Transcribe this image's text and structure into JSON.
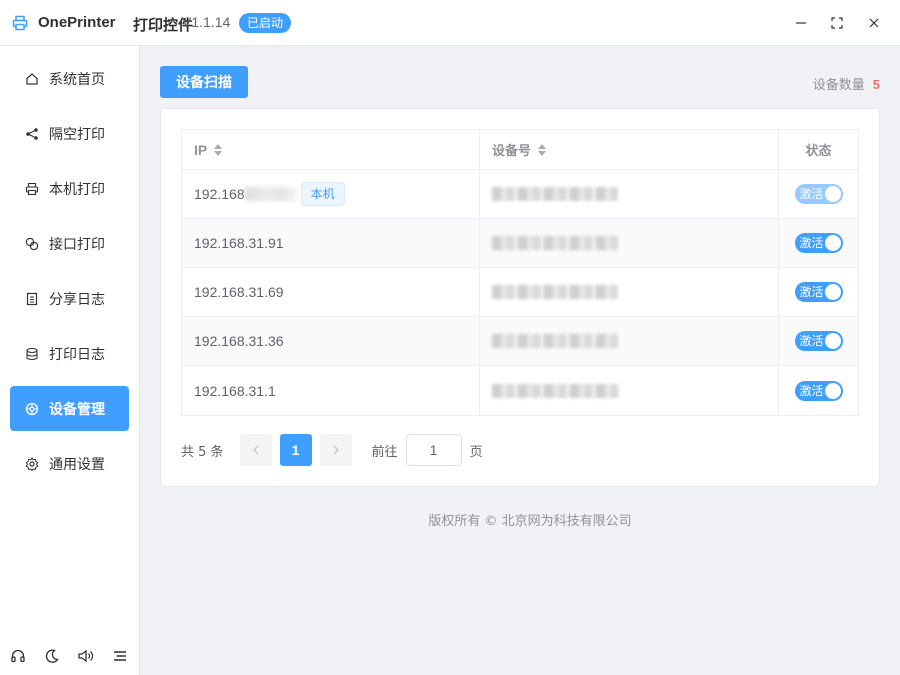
{
  "titlebar": {
    "app_name": "OnePrinter",
    "app_sub": "打印控件",
    "version": "V1.1.14",
    "status_badge": "已启动"
  },
  "sidebar": {
    "items": [
      {
        "label": "系统首页",
        "icon": "home-icon"
      },
      {
        "label": "隔空打印",
        "icon": "share-icon"
      },
      {
        "label": "本机打印",
        "icon": "printer-icon"
      },
      {
        "label": "接口打印",
        "icon": "link-icon"
      },
      {
        "label": "分享日志",
        "icon": "document-icon"
      },
      {
        "label": "打印日志",
        "icon": "database-icon"
      },
      {
        "label": "设备管理",
        "icon": "device-icon",
        "active": true
      },
      {
        "label": "通用设置",
        "icon": "gear-icon"
      }
    ],
    "footer_icons": [
      "headset-icon",
      "moon-icon",
      "speaker-icon",
      "menu-icon"
    ]
  },
  "main": {
    "scan_button": "设备扫描",
    "device_count_label": "设备数量",
    "device_count": "5"
  },
  "table": {
    "headers": {
      "ip": "IP",
      "device": "设备号",
      "status": "状态"
    },
    "local_tag": "本机",
    "rows": [
      {
        "ip": "192.168",
        "is_local": true,
        "status": "激活"
      },
      {
        "ip": "192.168.31.91",
        "status": "激活"
      },
      {
        "ip": "192.168.31.69",
        "status": "激活"
      },
      {
        "ip": "192.168.31.36",
        "status": "激活"
      },
      {
        "ip": "192.168.31.1",
        "status": "激活"
      }
    ]
  },
  "pagination": {
    "total": "共 5 条",
    "current_page": "1",
    "goto_label": "前往",
    "goto_value": "1",
    "page_label": "页"
  },
  "footer": {
    "copyright": "版权所有 ©  北京网为科技有限公司"
  },
  "colors": {
    "primary": "#409eff",
    "danger": "#f56c6c"
  }
}
